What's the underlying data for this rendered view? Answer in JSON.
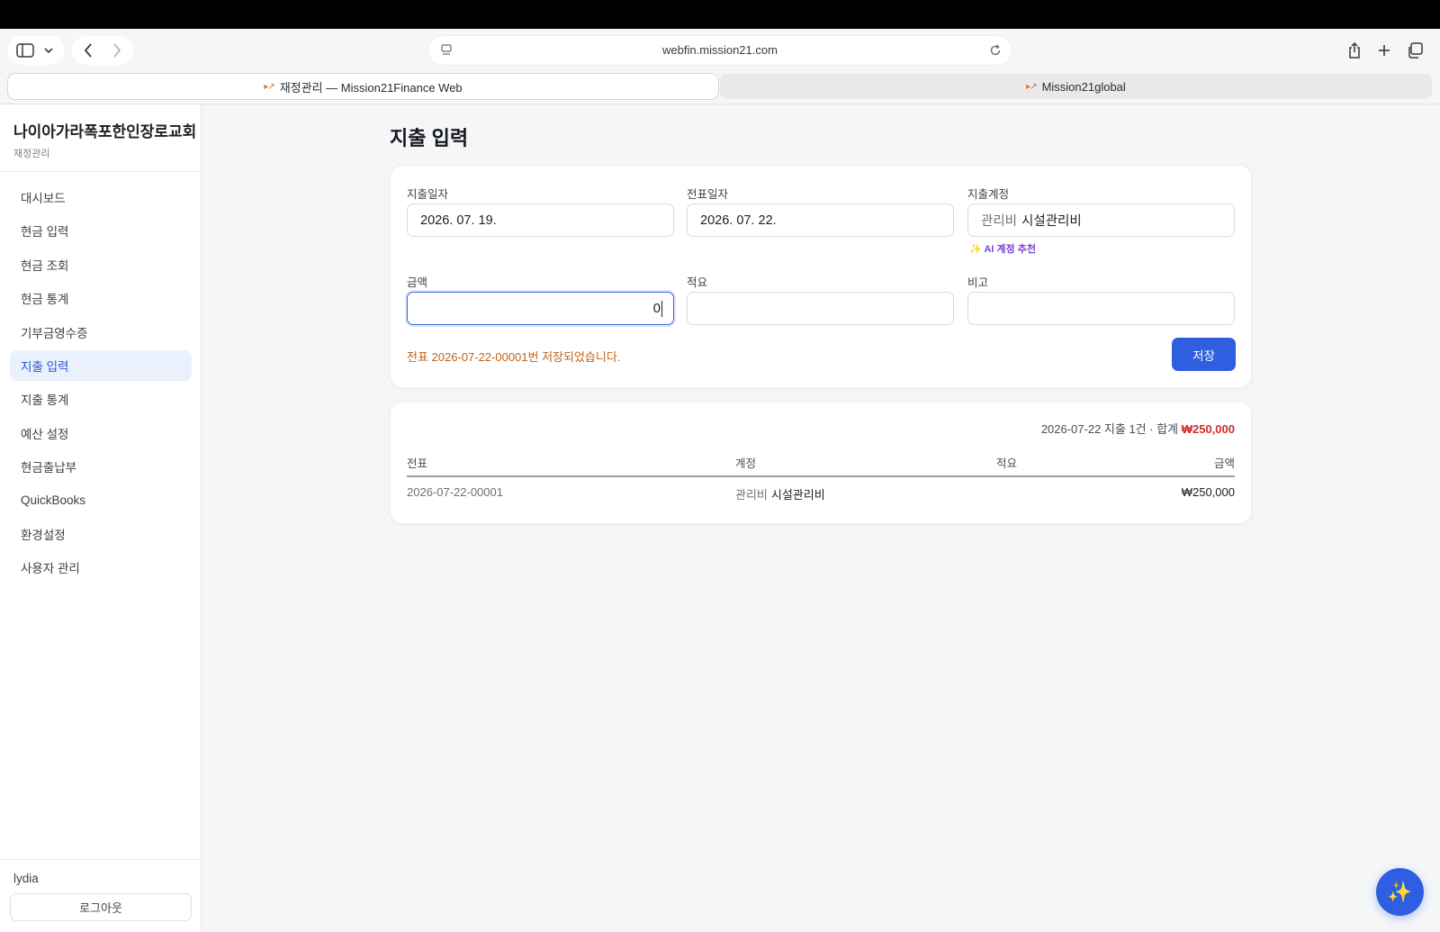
{
  "browser": {
    "url": "webfin.mission21.com",
    "tabs": [
      {
        "label": "재정관리 — Mission21Finance Web",
        "active": true
      },
      {
        "label": "Mission21global",
        "active": false
      }
    ]
  },
  "sidebar": {
    "org_name": "나이아가라폭포한인장로교회",
    "org_sub": "재정관리",
    "items": [
      {
        "label": "대시보드"
      },
      {
        "label": "현금 입력"
      },
      {
        "label": "현금 조회"
      },
      {
        "label": "현금 통계"
      },
      {
        "label": "기부금영수증"
      },
      {
        "label": "지출 입력",
        "active": true
      },
      {
        "label": "지출 통계"
      },
      {
        "label": "예산 설정"
      },
      {
        "label": "현금출납부"
      },
      {
        "label": "QuickBooks"
      },
      {
        "label": "환경설정"
      },
      {
        "label": "사용자 관리"
      }
    ],
    "user": "lydia",
    "logout_label": "로그아웃"
  },
  "page": {
    "title": "지출 입력"
  },
  "form": {
    "expense_date": {
      "label": "지출일자",
      "value": "2026. 07. 19."
    },
    "voucher_date": {
      "label": "전표일자",
      "value": "2026. 07. 22."
    },
    "account": {
      "label": "지출계정",
      "group": "관리비",
      "value": "시설관리비"
    },
    "ai_recommend": "✨ AI 계정 추천",
    "amount": {
      "label": "금액",
      "value": "0"
    },
    "description": {
      "label": "적요",
      "value": ""
    },
    "note": {
      "label": "비고",
      "value": ""
    },
    "message": "전표 2026-07-22-00001번 저장되었습니다.",
    "save_label": "저장"
  },
  "list": {
    "summary_prefix": "2026-07-22 지출 1건 · 합계 ",
    "summary_total": "₩250,000",
    "columns": [
      "전표",
      "계정",
      "적요",
      "금액"
    ],
    "rows": [
      {
        "voucher": "2026-07-22-00001",
        "account_group": "관리비",
        "account": "시설관리비",
        "description": "",
        "amount": "₩250,000"
      }
    ]
  },
  "colors": {
    "accent": "#2f5fe0",
    "message": "#c0631a",
    "total": "#d12a2a",
    "ai": "#7b3fd4"
  },
  "icons": [
    "sidebar-toggle-icon",
    "chevron-down-icon",
    "back-icon",
    "forward-icon",
    "reader-icon",
    "reload-icon",
    "share-icon",
    "new-tab-icon",
    "tabs-overview-icon",
    "sparkle-icon"
  ]
}
